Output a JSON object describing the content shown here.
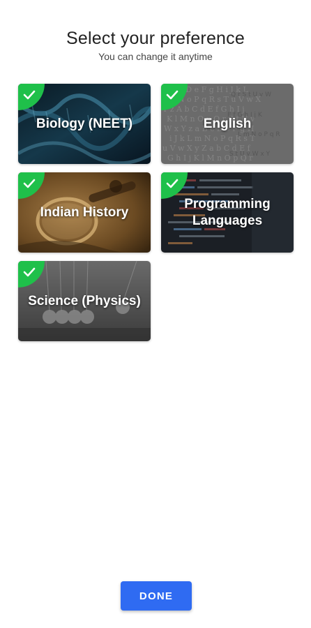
{
  "header": {
    "title": "Select your preference",
    "subtitle": "You can change it anytime"
  },
  "cards": [
    {
      "label": "Biology (NEET)",
      "selected": true,
      "theme": "dna-helix",
      "color": "#0f2430"
    },
    {
      "label": "English",
      "selected": true,
      "theme": "alphabet-letters",
      "color": "#6e6e6e"
    },
    {
      "label": "Indian History",
      "selected": true,
      "theme": "antique-magnifier",
      "color": "#6b4a22"
    },
    {
      "label": "Programming Languages",
      "selected": true,
      "theme": "code-screen",
      "color": "#1d2127"
    },
    {
      "label": "Science (Physics)",
      "selected": true,
      "theme": "newtons-cradle",
      "color": "#555555"
    }
  ],
  "check_color": "#1fc04a",
  "done_button": {
    "label": "DONE",
    "color": "#2f6bf2"
  }
}
